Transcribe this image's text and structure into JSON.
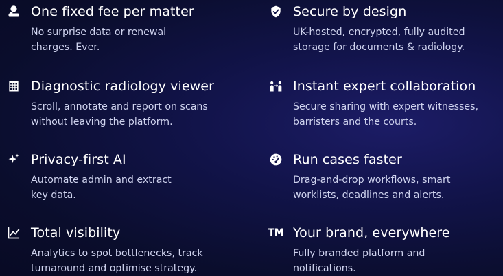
{
  "features": [
    {
      "title": "One fixed fee per matter",
      "desc_1": "No surprise data or renewal",
      "desc_2": "charges. Ever.",
      "icon": "coins-icon"
    },
    {
      "title": "Secure by design",
      "desc_1": "UK-hosted, encrypted, fully audited",
      "desc_2": "storage for documents & radiology.",
      "icon": "shield-check-icon"
    },
    {
      "title": "Diagnostic radiology viewer",
      "desc_1": "Scroll, annotate and report on scans",
      "desc_2": "without leaving the platform.",
      "icon": "calendar-grid-icon"
    },
    {
      "title": "Instant expert collaboration",
      "desc_1": "Secure sharing with expert witnesses,",
      "desc_2": "barristers and the courts.",
      "icon": "people-share-icon"
    },
    {
      "title": "Privacy-first AI",
      "desc_1": "Automate admin and extract",
      "desc_2": "key data.",
      "icon": "sparkle-icon"
    },
    {
      "title": "Run cases faster",
      "desc_1": "Drag-and-drop workflows, smart",
      "desc_2": "worklists, deadlines and alerts.",
      "icon": "speedometer-icon"
    },
    {
      "title": "Total visibility",
      "desc_1": "Analytics to spot bottlenecks, track",
      "desc_2": "turnaround and optimise strategy.",
      "icon": "line-chart-icon"
    },
    {
      "title": "Your brand, everywhere",
      "desc_1": "Fully branded platform and",
      "desc_2": "notifications.",
      "icon": "trademark-icon",
      "icon_text": "TM"
    }
  ]
}
